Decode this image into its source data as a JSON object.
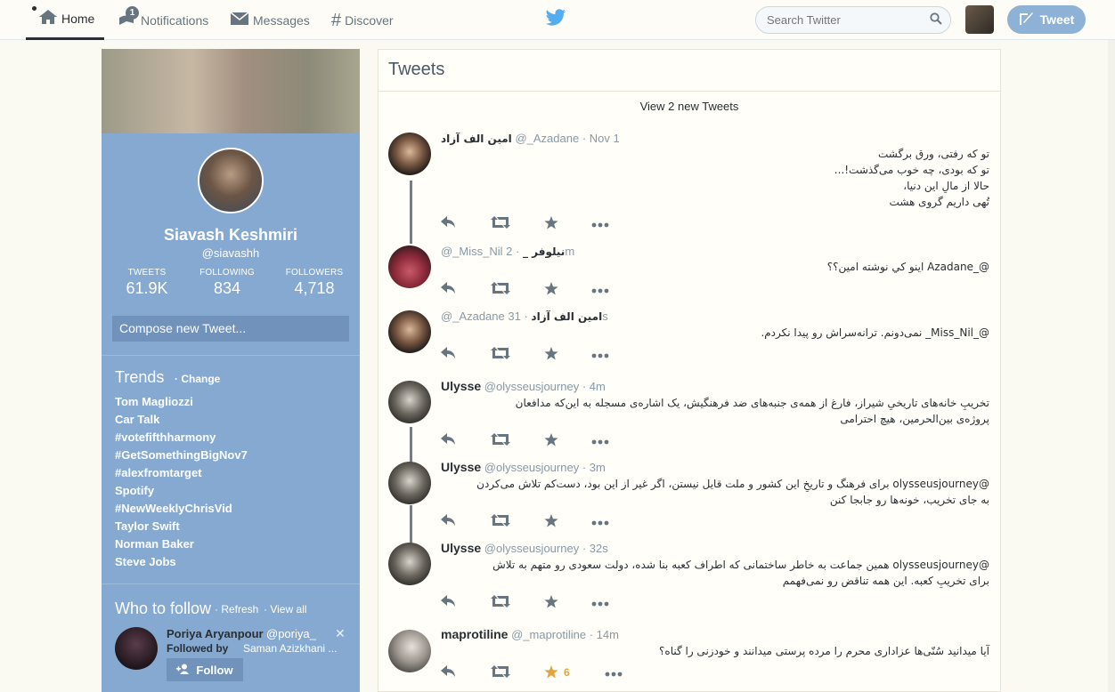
{
  "nav": {
    "home": "Home",
    "notifications": "Notifications",
    "notif_count": "1",
    "messages": "Messages",
    "discover": "Discover"
  },
  "search": {
    "placeholder": "Search Twitter"
  },
  "tweet_button": "Tweet",
  "profile": {
    "name": "Siavash Keshmiri",
    "handle": "@siavashh",
    "stats": [
      {
        "label": "TWEETS",
        "value": "61.9K"
      },
      {
        "label": "FOLLOWING",
        "value": "834"
      },
      {
        "label": "FOLLOWERS",
        "value": "4,718"
      }
    ],
    "compose": "Compose new Tweet..."
  },
  "trends": {
    "title": "Trends",
    "change": "· Change",
    "items": [
      "Tom Magliozzi",
      "Car Talk",
      "#votefifthharmony",
      "#GetSomethingBigNov7",
      "#alexfromtarget",
      "Spotify",
      "#NewWeeklyChrisVid",
      "Taylor Swift",
      "Norman Baker",
      "Steve Jobs"
    ]
  },
  "who_to_follow": {
    "title": "Who to follow",
    "refresh": "· Refresh",
    "view_all": "· View all",
    "suggestion": {
      "name": "Poriya Aryanpour",
      "handle": "@poriya_",
      "followed_by": "Followed by",
      "followed_by_name": "Saman Azizkhani ...",
      "follow_label": "Follow"
    }
  },
  "timeline": {
    "title": "Tweets",
    "view_new": "View 2 new Tweets",
    "tweets": [
      {
        "name": "امین الف آزاد",
        "handle": "@_Azadane",
        "time": "· Nov 1",
        "lines": [
          "تو که رفتی، ورق برگشت",
          "تو که بودی، چه خوب می‌گذشت!...",
          "حالا از مالِ این دنیا،",
          "تُهی داریم گروی هشت"
        ]
      },
      {
        "name": "نیلوفر _",
        "handle": "@_Miss_Nil",
        "time": "· 2m",
        "lines": [
          "@_Azadane اینو کي نوشته امین؟؟"
        ]
      },
      {
        "name": "امین الف آزاد",
        "handle": "@_Azadane",
        "time": "· 31s",
        "lines": [
          "@_Miss_Nil_ نمی‌دونم. ترانه‌سراش رو پیدا نکردم."
        ]
      },
      {
        "name": "Ulysse",
        "handle": "@olysseusjourney",
        "time": "· 4m",
        "lines": [
          "تخریبِ خانه‌های تاریخیِ شیراز، فارغ از همه‌ی جنبه‌های ضد فرهنگیش، یک اشاره‌ی مسجله به این‌که مدافعان",
          "پروژه‌ی بین‌الحرمین، هیچ احترامی"
        ]
      },
      {
        "name": "Ulysse",
        "handle": "@olysseusjourney",
        "time": "· 3m",
        "lines": [
          "@olysseusjourney برای فرهنگ و تاریخِ این کشور و ملت قایل نیستن، اگر غیر از این بود، دست‌کم تلاش می‌کردن",
          "به جای تخریب، خونه‌ها رو جابجا کنن"
        ]
      },
      {
        "name": "Ulysse",
        "handle": "@olysseusjourney",
        "time": "· 32s",
        "lines": [
          "@olysseusjourney همین جماعت به خاطر ساختمانی که اطراف کعبه بنا شده، دولت سعودی رو متهم به تلاش",
          "برای تخریبِ کعبه. این همه تناقض رو نمی‌فهمم"
        ]
      },
      {
        "name": "maprotiline",
        "handle": "@_maprotiline",
        "time": "· 14m",
        "lines": [
          "آیا میدانید سُنّی‌ها عزاداری محرم را مرده پرستی میدانند و خودزنی را گناه؟"
        ],
        "fav_count": "6"
      }
    ]
  },
  "colors": {
    "accent": "#85a9d0",
    "tweet_button": "#8eb1d6",
    "favorited": "#e2a43e",
    "bird": "#55acee"
  }
}
